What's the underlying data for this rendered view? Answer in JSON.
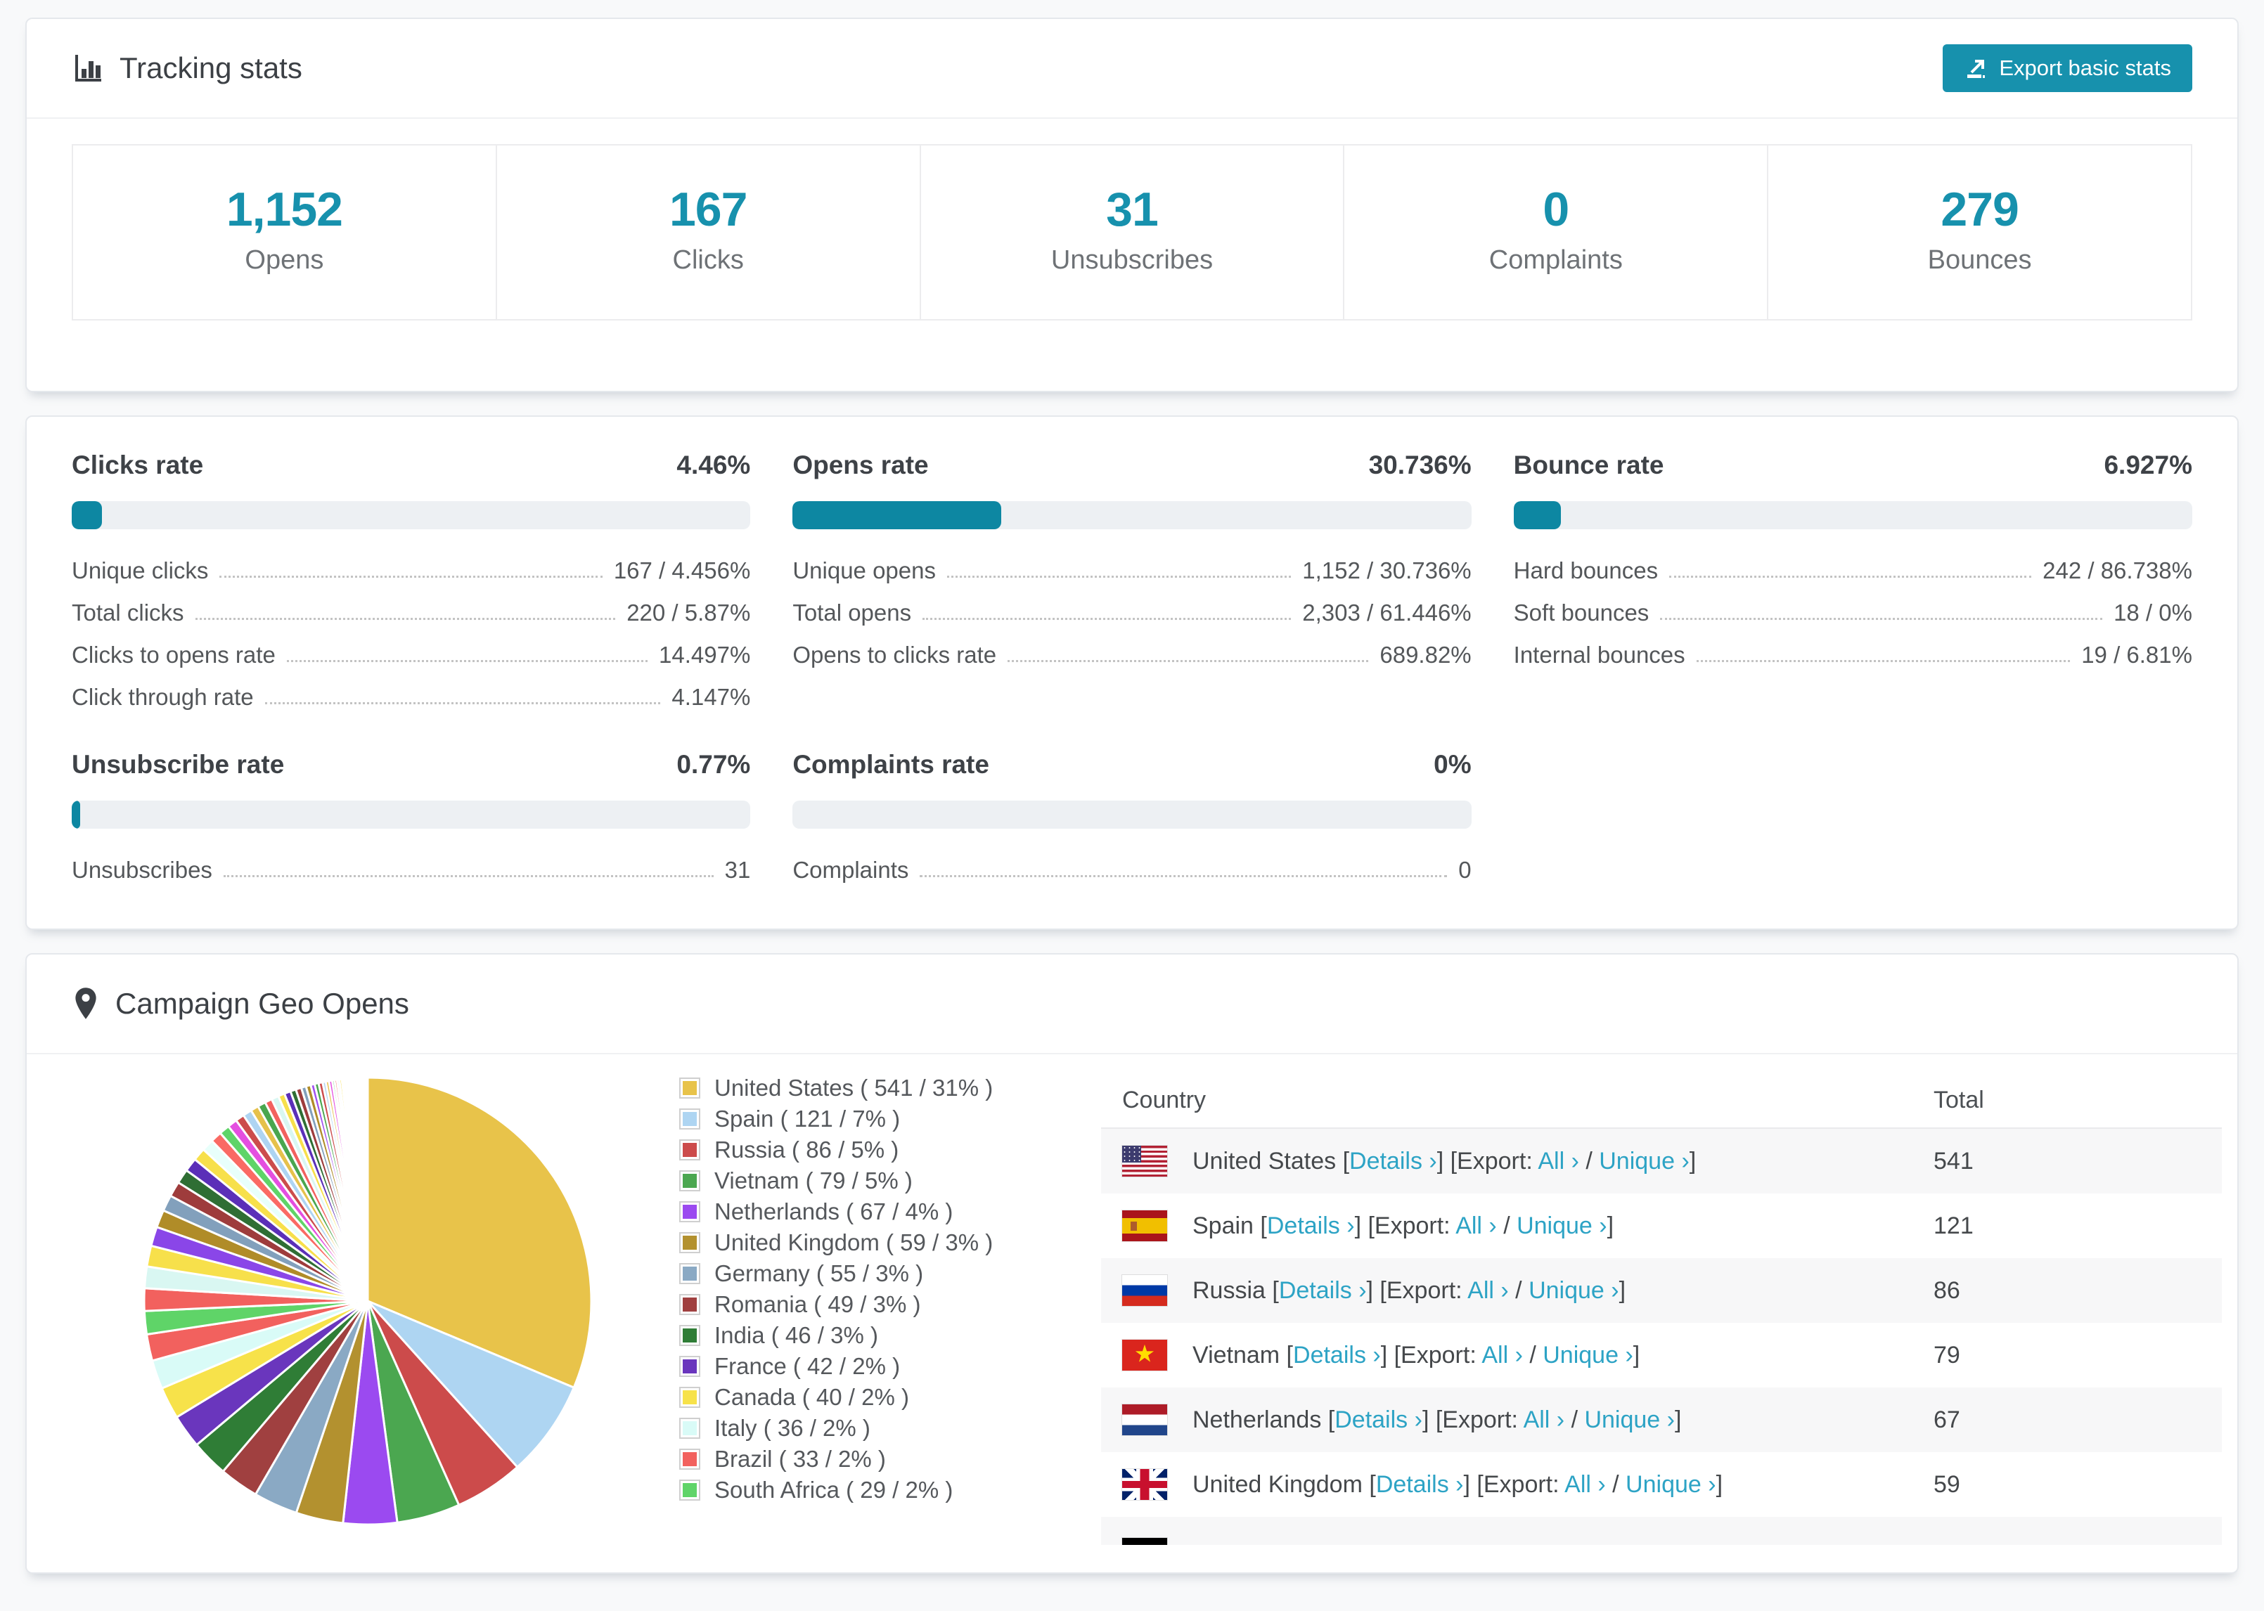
{
  "colors": {
    "accent": "#1791ad",
    "bar_fill": "#0d87a2",
    "link": "#2da3c5",
    "pie_stroke": "#ffffff"
  },
  "tracking": {
    "title": "Tracking stats",
    "export_label": "Export basic stats",
    "stats": [
      {
        "id": "opens",
        "value": "1,152",
        "label": "Opens"
      },
      {
        "id": "clicks",
        "value": "167",
        "label": "Clicks"
      },
      {
        "id": "unsubscribes",
        "value": "31",
        "label": "Unsubscribes"
      },
      {
        "id": "complaints",
        "value": "0",
        "label": "Complaints"
      },
      {
        "id": "bounces",
        "value": "279",
        "label": "Bounces"
      }
    ]
  },
  "rates": {
    "sections": [
      {
        "id": "clicks-rate",
        "title": "Clicks rate",
        "value": "4.46%",
        "bar_pct": 4.46,
        "rows": [
          {
            "label": "Unique clicks",
            "value": "167 / 4.456%"
          },
          {
            "label": "Total clicks",
            "value": "220 / 5.87%"
          },
          {
            "label": "Clicks to opens rate",
            "value": "14.497%"
          },
          {
            "label": "Click through rate",
            "value": "4.147%"
          }
        ]
      },
      {
        "id": "opens-rate",
        "title": "Opens rate",
        "value": "30.736%",
        "bar_pct": 30.736,
        "rows": [
          {
            "label": "Unique opens",
            "value": "1,152 / 30.736%"
          },
          {
            "label": "Total opens",
            "value": "2,303 / 61.446%"
          },
          {
            "label": "Opens to clicks rate",
            "value": "689.82%"
          }
        ]
      },
      {
        "id": "bounce-rate",
        "title": "Bounce rate",
        "value": "6.927%",
        "bar_pct": 6.927,
        "rows": [
          {
            "label": "Hard bounces",
            "value": "242 / 86.738%"
          },
          {
            "label": "Soft bounces",
            "value": "18 / 0%"
          },
          {
            "label": "Internal bounces",
            "value": "19 / 6.81%"
          }
        ]
      },
      {
        "id": "unsubscribe-rate",
        "title": "Unsubscribe rate",
        "value": "0.77%",
        "bar_pct": 0.77,
        "rows": [
          {
            "label": "Unsubscribes",
            "value": "31"
          }
        ]
      },
      {
        "id": "complaints-rate",
        "title": "Complaints rate",
        "value": "0%",
        "bar_pct": 0,
        "rows": [
          {
            "label": "Complaints",
            "value": "0"
          }
        ]
      }
    ]
  },
  "geo": {
    "title": "Campaign Geo Opens",
    "table": {
      "country_header": "Country",
      "total_header": "Total",
      "details_label": "Details ›",
      "export_label": "Export:",
      "all_label": "All ›",
      "unique_label": "Unique ›",
      "rows": [
        {
          "country": "United States",
          "flag": "us",
          "total": "541"
        },
        {
          "country": "Spain",
          "flag": "es",
          "total": "121"
        },
        {
          "country": "Russia",
          "flag": "ru",
          "total": "86"
        },
        {
          "country": "Vietnam",
          "flag": "vn",
          "total": "79"
        },
        {
          "country": "Netherlands",
          "flag": "nl",
          "total": "67"
        },
        {
          "country": "United Kingdom",
          "flag": "gb",
          "total": "59"
        }
      ],
      "partial_row": {
        "flag": "de"
      }
    }
  },
  "chart_data": {
    "type": "pie",
    "title": "Campaign Geo Opens",
    "legend_position": "right-of-pie",
    "start_angle_deg": -90,
    "direction": "clockwise",
    "slices": [
      {
        "name": "United States",
        "value": 541,
        "pct": 31,
        "color": "#e8c34a"
      },
      {
        "name": "Spain",
        "value": 121,
        "pct": 7,
        "color": "#aed5f2"
      },
      {
        "name": "Russia",
        "value": 86,
        "pct": 5,
        "color": "#cc4b4b"
      },
      {
        "name": "Vietnam",
        "value": 79,
        "pct": 5,
        "color": "#4ba750"
      },
      {
        "name": "Netherlands",
        "value": 67,
        "pct": 4,
        "color": "#9b4af0"
      },
      {
        "name": "United Kingdom",
        "value": 59,
        "pct": 3,
        "color": "#b3912f"
      },
      {
        "name": "Germany",
        "value": 55,
        "pct": 3,
        "color": "#8aa9c4"
      },
      {
        "name": "Romania",
        "value": 49,
        "pct": 3,
        "color": "#a04040"
      },
      {
        "name": "India",
        "value": 46,
        "pct": 3,
        "color": "#2f7d36"
      },
      {
        "name": "France",
        "value": 42,
        "pct": 2,
        "color": "#6a36bd"
      },
      {
        "name": "Canada",
        "value": 40,
        "pct": 2,
        "color": "#f7e24a"
      },
      {
        "name": "Italy",
        "value": 36,
        "pct": 2,
        "color": "#d9fbf7"
      },
      {
        "name": "Brazil",
        "value": 33,
        "pct": 2,
        "color": "#f2615e"
      },
      {
        "name": "South Africa",
        "value": 29,
        "pct": 2,
        "color": "#5fd468"
      }
    ],
    "others": [
      {
        "v": 28,
        "c": "#f2615e"
      },
      {
        "v": 27,
        "c": "#d9f7f2"
      },
      {
        "v": 26,
        "c": "#f7e04b"
      },
      {
        "v": 24,
        "c": "#8a46e8"
      },
      {
        "v": 22,
        "c": "#b08c28"
      },
      {
        "v": 20,
        "c": "#82a0bc"
      },
      {
        "v": 19,
        "c": "#9e3c3c"
      },
      {
        "v": 18,
        "c": "#2f6e34"
      },
      {
        "v": 17,
        "c": "#5b2fb8"
      },
      {
        "v": 16,
        "c": "#f7e04b"
      },
      {
        "v": 15,
        "c": "#e8fffb"
      },
      {
        "v": 14,
        "c": "#fa6a64"
      },
      {
        "v": 13,
        "c": "#5fd468"
      },
      {
        "v": 12,
        "c": "#e44fe0"
      },
      {
        "v": 11,
        "c": "#cc4c4c"
      },
      {
        "v": 11,
        "c": "#aed4f2"
      },
      {
        "v": 10,
        "c": "#e6c14b"
      },
      {
        "v": 10,
        "c": "#4aa64f"
      },
      {
        "v": 9,
        "c": "#f2615e"
      },
      {
        "v": 9,
        "c": "#d9f7f2"
      },
      {
        "v": 8,
        "c": "#f7e04b"
      },
      {
        "v": 8,
        "c": "#5b2fb8"
      },
      {
        "v": 7,
        "c": "#2f6e34"
      },
      {
        "v": 7,
        "c": "#9e3c3c"
      },
      {
        "v": 6,
        "c": "#82a0bc"
      },
      {
        "v": 6,
        "c": "#b08c28"
      },
      {
        "v": 5,
        "c": "#a04ff0"
      },
      {
        "v": 5,
        "c": "#4aa64f"
      },
      {
        "v": 5,
        "c": "#cc4c4c"
      },
      {
        "v": 4,
        "c": "#aed4f2"
      },
      {
        "v": 4,
        "c": "#e6c14b"
      },
      {
        "v": 4,
        "c": "#e44fe0"
      },
      {
        "v": 3,
        "c": "#5fd468"
      },
      {
        "v": 3,
        "c": "#fa6a64"
      },
      {
        "v": 3,
        "c": "#d9f7f2"
      },
      {
        "v": 3,
        "c": "#f7e04b"
      },
      {
        "v": 2,
        "c": "#5b2fb8"
      },
      {
        "v": 2,
        "c": "#1a237e"
      },
      {
        "v": 2,
        "c": "#2f6e34"
      },
      {
        "v": 2,
        "c": "#9e3c3c"
      },
      {
        "v": 2,
        "c": "#82a0bc"
      },
      {
        "v": 2,
        "c": "#b08c28"
      },
      {
        "v": 2,
        "c": "#a04ff0"
      },
      {
        "v": 2,
        "c": "#66e07a"
      },
      {
        "v": 1,
        "c": "#ff5cd0"
      },
      {
        "v": 1,
        "c": "#aed4f2"
      },
      {
        "v": 1,
        "c": "#f2615e"
      },
      {
        "v": 1,
        "c": "#f7e04b"
      },
      {
        "v": 1,
        "c": "#2f6e34"
      },
      {
        "v": 1,
        "c": "#5b2fb8"
      },
      {
        "v": 1,
        "c": "#cc4c4c"
      },
      {
        "v": 1,
        "c": "#d9f7f2"
      },
      {
        "v": 1,
        "c": "#b08c28"
      },
      {
        "v": 1,
        "c": "#82a0bc"
      },
      {
        "v": 1,
        "c": "#9e3c3c"
      },
      {
        "v": 1,
        "c": "#4aa64f"
      },
      {
        "v": 1,
        "c": "#e44fe0"
      },
      {
        "v": 1,
        "c": "#e6c14b"
      },
      {
        "v": 1,
        "c": "#a04ff0"
      },
      {
        "v": 1,
        "c": "#fa6a64"
      }
    ]
  }
}
